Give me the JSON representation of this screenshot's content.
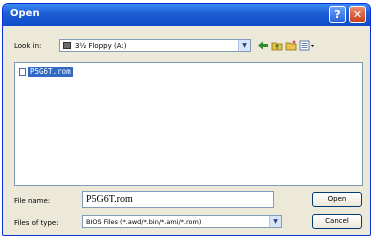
{
  "window": {
    "title": "Open"
  },
  "title_buttons": {
    "help": "?",
    "close": "✕"
  },
  "lookin": {
    "label": "Look in:",
    "value": "3½ Floppy (A:)"
  },
  "toolbar": {
    "back_icon": "back-arrow-icon",
    "up_icon": "up-folder-icon",
    "new_folder_icon": "new-folder-icon",
    "views_icon": "views-menu-icon"
  },
  "files": [
    {
      "name": "P5G6T.rom",
      "selected": true
    }
  ],
  "filename": {
    "label": "File name:",
    "value": "P5G6T.rom"
  },
  "filetype": {
    "label": "Files of type:",
    "value": "BIOS Files (*.awd/*.bin/*.ami/*.rom)"
  },
  "buttons": {
    "open": "Open",
    "cancel": "Cancel"
  },
  "colors": {
    "titlebar": "#0c4cc8",
    "selection": "#316ac5",
    "dialog_bg": "#ece9d8"
  }
}
